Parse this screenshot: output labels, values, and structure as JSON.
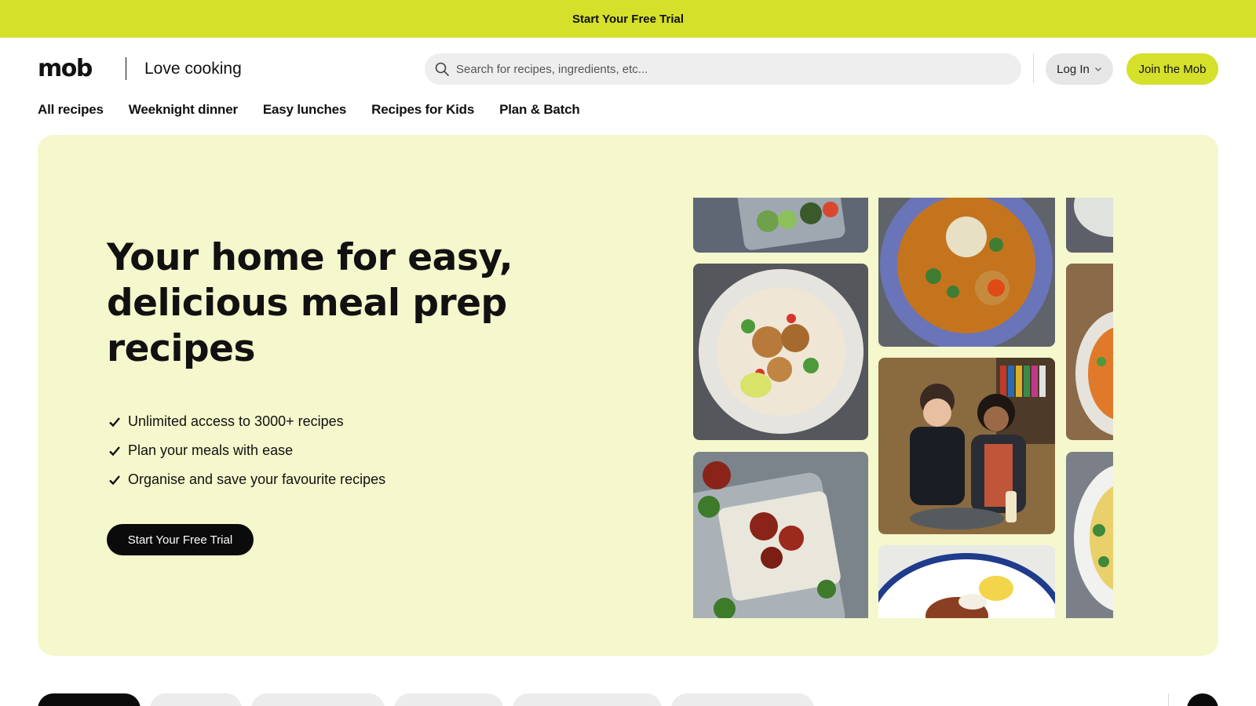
{
  "promo": {
    "text": "Start Your Free Trial"
  },
  "header": {
    "logo": "mob",
    "tagline": "Love cooking",
    "search_placeholder": "Search for recipes, ingredients, etc...",
    "login_label": "Log In",
    "join_label": "Join the Mob"
  },
  "nav": {
    "items": [
      {
        "label": "All recipes"
      },
      {
        "label": "Weeknight dinner"
      },
      {
        "label": "Easy lunches"
      },
      {
        "label": "Recipes for Kids"
      },
      {
        "label": "Plan & Batch"
      }
    ]
  },
  "hero": {
    "title": "Your home for easy, delicious meal prep recipes",
    "features": [
      "Unlimited access to 3000+ recipes",
      "Plan your meals with ease",
      "Organise and save your favourite recipes"
    ],
    "cta_label": "Start Your Free Trial"
  },
  "icons": {
    "search": "search-icon",
    "chevron": "chevron-down-icon",
    "check": "check-icon"
  },
  "colors": {
    "accent": "#d4e02a",
    "hero_bg": "#f5f7cc",
    "dark": "#0b0b0b"
  }
}
